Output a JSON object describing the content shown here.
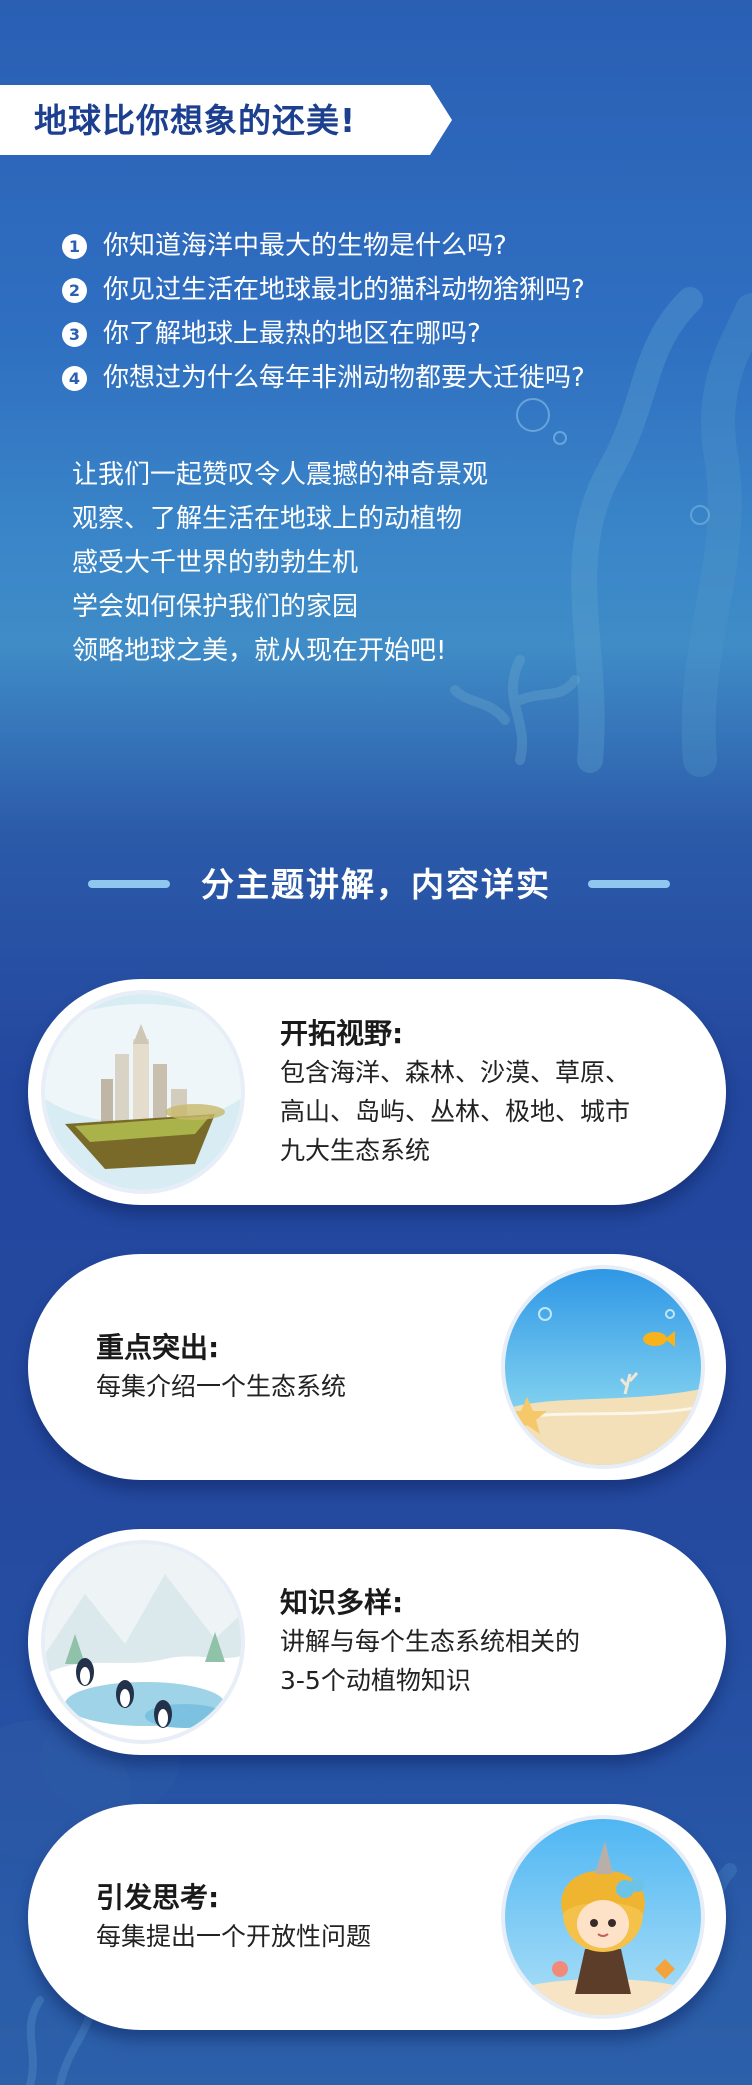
{
  "header": {
    "title": "地球比你想象的还美!"
  },
  "questions": [
    {
      "num": "1",
      "text": "你知道海洋中最大的生物是什么吗?"
    },
    {
      "num": "2",
      "text": "你见过生活在地球最北的猫科动物猞猁吗?"
    },
    {
      "num": "3",
      "text": "你了解地球上最热的地区在哪吗?"
    },
    {
      "num": "4",
      "text": "你想过为什么每年非洲动物都要大迁徙吗?"
    }
  ],
  "intro": [
    "让我们一起赞叹令人震撼的神奇景观",
    "观察、了解生活在地球上的动植物",
    "感受大千世界的勃勃生机",
    "学会如何保护我们的家园",
    "领略地球之美，就从现在开始吧!"
  ],
  "section": {
    "title": "分主题讲解，内容详实"
  },
  "cards": [
    {
      "heading": "开拓视野:",
      "lines": [
        "包含海洋、森林、沙漠、草原、",
        "高山、岛屿、丛林、极地、城市",
        "九大生态系统"
      ],
      "image_icon": "floating-city-island-icon"
    },
    {
      "heading": "重点突出:",
      "lines": [
        "每集介绍一个生态系统"
      ],
      "image_icon": "ocean-beach-icon"
    },
    {
      "heading": "知识多样:",
      "lines": [
        "讲解与每个生态系统相关的",
        "3-5个动植物知识"
      ],
      "image_icon": "penguins-snow-icon"
    },
    {
      "heading": "引发思考:",
      "lines": [
        "每集提出一个开放性问题"
      ],
      "image_icon": "cartoon-girl-icon"
    }
  ],
  "colors": {
    "title_text": "#1c3f8f",
    "background_top": "#2a5fb4",
    "background_bottom": "#24489e",
    "card": "#ffffff",
    "dash_accent": "#8fc7ef"
  }
}
